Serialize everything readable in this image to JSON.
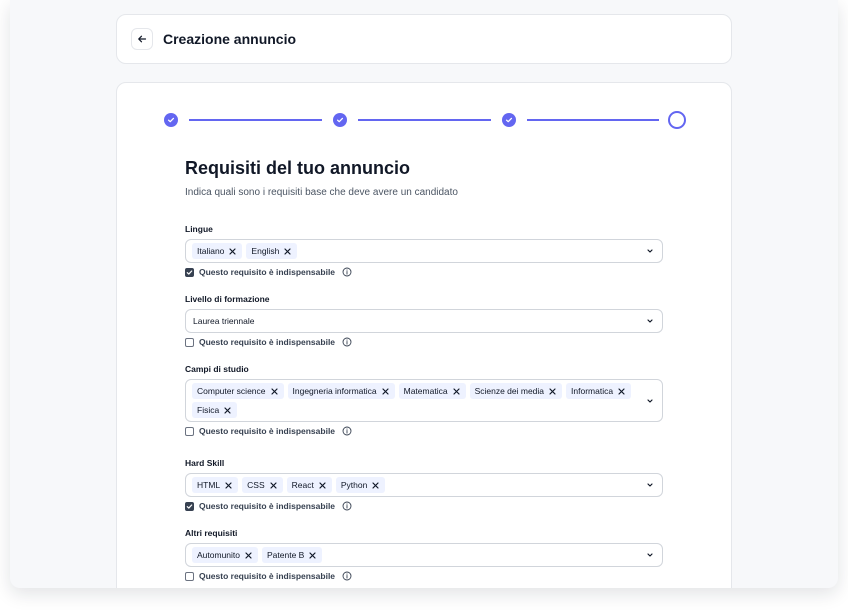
{
  "header": {
    "title": "Creazione annuncio",
    "back_icon": "arrow-left-icon"
  },
  "stepper": {
    "steps": [
      {
        "state": "done"
      },
      {
        "state": "done"
      },
      {
        "state": "done"
      },
      {
        "state": "current"
      }
    ]
  },
  "section": {
    "title": "Requisiti del tuo annuncio",
    "subtitle": "Indica quali sono i requisiti base che deve avere un candidato"
  },
  "fields": [
    {
      "label": "Lingue",
      "chips": [
        "Italiano",
        "English"
      ],
      "required_label": "Questo requisito è indispensabile",
      "required_checked": true
    },
    {
      "label": "Livello di formazione",
      "value": "Laurea triennale",
      "required_label": "Questo requisito è indispensabile",
      "required_checked": false
    },
    {
      "label": "Campi di studio",
      "chips": [
        "Computer science",
        "Ingegneria informatica",
        "Matematica",
        "Scienze dei media",
        "Informatica",
        "Fisica"
      ],
      "required_label": "Questo requisito è indispensabile",
      "required_checked": false
    },
    {
      "label": "Hard Skill",
      "chips": [
        "HTML",
        "CSS",
        "React",
        "Python"
      ],
      "required_label": "Questo requisito è indispensabile",
      "required_checked": true
    },
    {
      "label": "Altri requisiti",
      "chips": [
        "Automunito",
        "Patente B"
      ],
      "required_label": "Questo requisito è indispensabile",
      "required_checked": false
    }
  ],
  "colors": {
    "accent": "#6366f1",
    "chip_bg": "#eef2ff",
    "border": "#d1d5db"
  }
}
